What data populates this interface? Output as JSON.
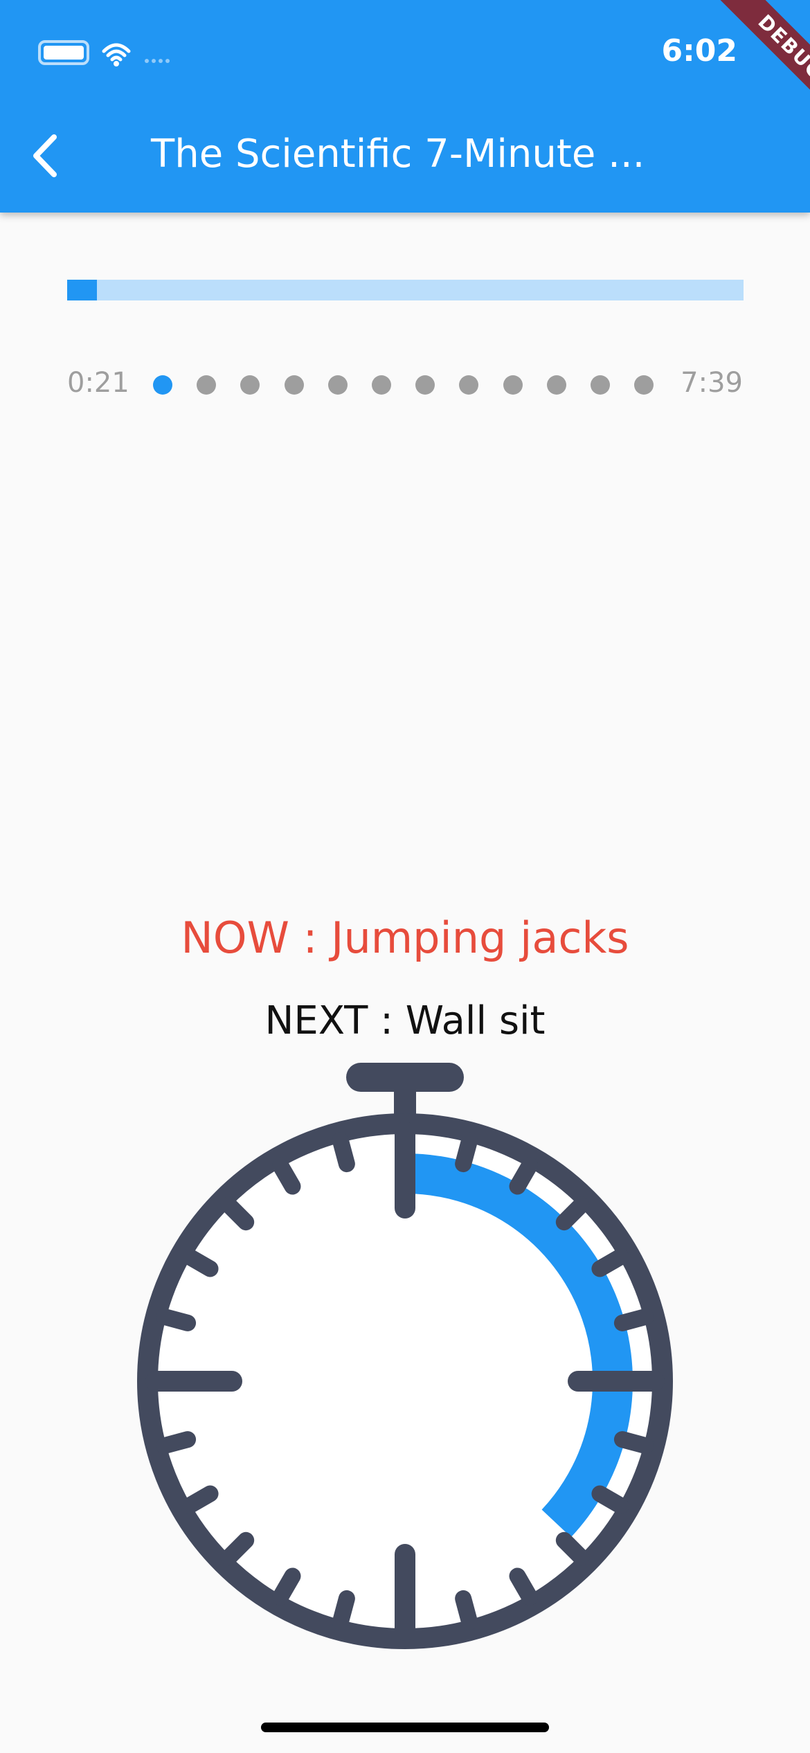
{
  "status_bar": {
    "time": "6:02"
  },
  "debug_banner": "DEBUG",
  "app_bar": {
    "title": "The Scientific 7-Minute ...",
    "back_icon": "chevron-left-icon",
    "color": "#2196f3"
  },
  "progress": {
    "fraction": 0.044,
    "fill_color": "#2196f3",
    "track_color": "#bbdefb"
  },
  "timeline": {
    "elapsed": "0:21",
    "remaining": "7:39",
    "step_count": 12,
    "active_step": 0
  },
  "workout": {
    "now": "NOW : Jumping jacks",
    "next": "NEXT : Wall sit"
  },
  "stopwatch": {
    "icon": "stopwatch-icon",
    "progress_fraction": 0.37,
    "accent_color": "#2196f3",
    "body_color": "#434a5e"
  }
}
